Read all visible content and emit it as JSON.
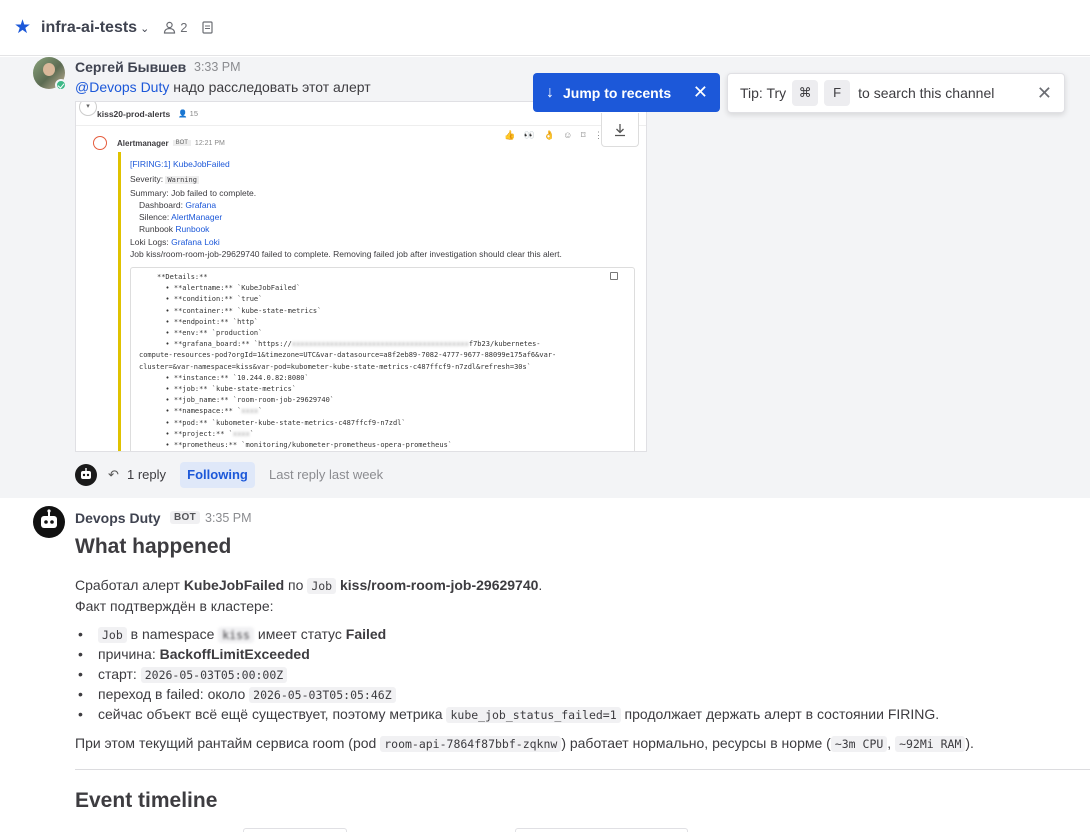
{
  "header": {
    "channel_name": "infra-ai-tests",
    "member_count": "2",
    "icons": [
      "star-icon",
      "chevron-down-icon",
      "member-icon",
      "pinned-icon"
    ]
  },
  "colors": {
    "accent": "#1c58d9",
    "highlight_bg": "#f3f4f6",
    "online": "#3db887"
  },
  "post1": {
    "author": "Сергей Бывшев",
    "time": "3:33 PM",
    "mention": "@Devops Duty",
    "text": " надо расследовать этот алерт",
    "screenshot": {
      "channel": "kiss20-prod-alerts",
      "channel_members": "15",
      "author": "Alertmanager",
      "bot": "BOT",
      "time": "12:21 PM",
      "title": "[FIRING:1] KubeJobFailed",
      "severity_label": "Severity:",
      "severity": "Warning",
      "summary": "Summary: Job failed to complete.",
      "dashboard_label": "Dashboard:",
      "dashboard_link": "Grafana",
      "silence_label": "Silence:",
      "silence_link": "AlertManager",
      "runbook_label": "Runbook",
      "runbook_link": "Runbook",
      "loki_label": "Loki Logs:",
      "loki_link": "Grafana Loki",
      "description": "Job kiss/room-room-job-29629740 failed to complete. Removing failed job after investigation should clear this alert.",
      "code_lines": [
        "**Details:**",
        "  • **alertname:** `KubeJobFailed`",
        "  • **condition:** `true`",
        "  • **container:** `kube-state-metrics`",
        "  • **endpoint:** `http`",
        "  • **env:** `production`",
        "  • **grafana_board:** `https://",
        "compute-resources-pod?orgId=1&timezone=UTC&var-datasource=a8f2eb89-7082-4777-9677-88099e175af6&var-",
        "cluster=&var-namespace=kiss&var-pod=kubometer-kube-state-metrics-c487ffcf9-n7zdl&refresh=30s`",
        "  • **instance:** `10.244.0.82:8080`",
        "  • **job:** `kube-state-metrics`",
        "  • **job_name:** `room-room-job-29629740`",
        "  • **namespace:** `",
        "  • **pod:** `kubometer-kube-state-metrics-c487ffcf9-n7zdl`",
        "  • **project:** `",
        "  • **prometheus:** `monitoring/kubometer-prometheus-opera-prometheus`"
      ],
      "grafana_tail": "f7b23/kubernetes-"
    }
  },
  "jump_toast": {
    "label": "Jump to recents"
  },
  "tip_toast": {
    "prefix": "Tip: Try",
    "key1": "⌘",
    "key2": "F",
    "suffix": "to search this channel"
  },
  "thread": {
    "reply_count": "1 reply",
    "following": "Following",
    "last_reply": "Last reply last week"
  },
  "post2": {
    "author": "Devops Duty",
    "badge": "BOT",
    "time": "3:35 PM",
    "heading1": "What happened",
    "p1": {
      "a": "Сработал алерт ",
      "alert": "KubeJobFailed",
      "b": " по ",
      "job_code": "Job",
      "c": " ",
      "job_name": "kiss/room-room-job-29629740",
      "d": "."
    },
    "p2": "Факт подтверждён в кластере:",
    "bullets": {
      "b1": {
        "code": "Job",
        "a": " в namespace ",
        "ns": "kiss",
        "b": " имеет статус ",
        "status": "Failed"
      },
      "b2": {
        "a": "причина: ",
        "reason": "BackoffLimitExceeded"
      },
      "b3": {
        "a": "старт: ",
        "code": "2026-05-03T05:00:00Z"
      },
      "b4": {
        "a": "переход в failed: около ",
        "code": "2026-05-03T05:05:46Z"
      },
      "b5": {
        "a": "сейчас объект всё ещё существует, поэтому метрика ",
        "code": "kube_job_status_failed=1",
        "b": " продолжает держать алерт в состоянии FIRING."
      }
    },
    "p3": {
      "a": "При этом текущий рантайм сервиса room (pod ",
      "pod": "room-api-7864f87bbf-zqknw",
      "b": ") работает нормально, ресурсы в норме (",
      "cpu": "~3m CPU",
      "c": ", ",
      "ram": "~92Mi RAM",
      "d": ")."
    },
    "heading2": "Event timeline"
  }
}
